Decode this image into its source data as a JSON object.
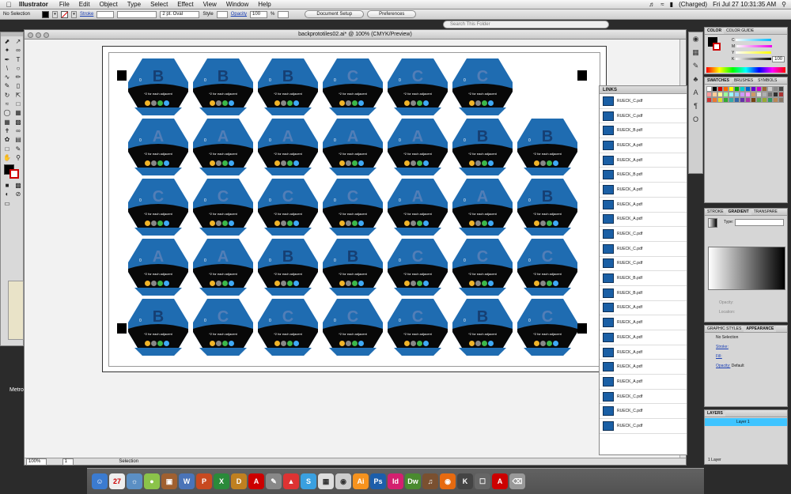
{
  "menubar": {
    "app": "Illustrator",
    "items": [
      "File",
      "Edit",
      "Object",
      "Type",
      "Select",
      "Effect",
      "View",
      "Window",
      "Help"
    ],
    "battery": "(Charged)",
    "clock": "Fri Jul 27  10:31:35 AM"
  },
  "control": {
    "selection": "No Selection",
    "stroke_label": "Stroke",
    "brush": "2 pt. Oval",
    "style_label": "Style",
    "opacity_label": "Opacity",
    "opacity_value": "100",
    "percent": "%",
    "doc_setup": "Document Setup",
    "preferences": "Preferences",
    "search_placeholder": "Search This Folder"
  },
  "document": {
    "title": "backprototiles02.ai* @ 100% (CMYK/Preview)",
    "zoom": "100%",
    "page": "1",
    "status": "Selection"
  },
  "tiles": {
    "zero": "0",
    "adjacent": "*2 for each adjacent",
    "rows": [
      [
        "B",
        "B",
        "B",
        "C",
        "C",
        "C"
      ],
      [
        "A",
        "A",
        "A",
        "A",
        "A",
        "B",
        "B"
      ],
      [
        "C",
        "C",
        "C",
        "C",
        "A",
        "A",
        "B"
      ],
      [
        "A",
        "A",
        "B",
        "B",
        "C",
        "C",
        "C"
      ],
      [
        "B",
        "C",
        "C",
        "C",
        "C",
        "B",
        "C"
      ]
    ]
  },
  "links_panel": {
    "title": "LINKS",
    "files": [
      "RUECK_C.pdf",
      "RUECK_C.pdf",
      "RUECK_B.pdf",
      "RUECK_A.pdf",
      "RUECK_A.pdf",
      "RUECK_B.pdf",
      "RUECK_A.pdf",
      "RUECK_A.pdf",
      "RUECK_A.pdf",
      "RUECK_C.pdf",
      "RUECK_C.pdf",
      "RUECK_C.pdf",
      "RUECK_B.pdf",
      "RUECK_B.pdf",
      "RUECK_A.pdf",
      "RUECK_A.pdf",
      "RUECK_A.pdf",
      "RUECK_A.pdf",
      "RUECK_A.pdf",
      "RUECK_A.pdf",
      "RUECK_C.pdf",
      "RUECK_C.pdf",
      "RUECK_C.pdf"
    ]
  },
  "color_panel": {
    "tabs": [
      "COLOR",
      "COLOR GUIDE"
    ],
    "channels": [
      "C",
      "M",
      "Y",
      "K"
    ],
    "k_value": "100"
  },
  "swatches_panel": {
    "tabs": [
      "SWATCHES",
      "BRUSHES",
      "SYMBOLS"
    ]
  },
  "stroke_panel": {
    "tabs": [
      "STROKE",
      "GRADIENT",
      "TRANSPARE"
    ],
    "type_label": "Type:",
    "opacity_label": "Opacity:",
    "location_label": "Location:"
  },
  "appearance_panel": {
    "tabs": [
      "GRAPHIC STYLES",
      "APPEARANCE"
    ],
    "selection": "No Selection",
    "stroke": "Stroke:",
    "fill": "Fill:",
    "opacity": "Opacity:",
    "opacity_value": "Default"
  },
  "layers_panel": {
    "tab": "LAYERS",
    "layer": "Layer 1",
    "count": "1 Layer"
  },
  "desktop": {
    "label": "Metro"
  },
  "colors": {
    "tile_blue": "#1f6cb1",
    "tile_black": "#080808",
    "panel_bg": "#d6d6d6"
  }
}
